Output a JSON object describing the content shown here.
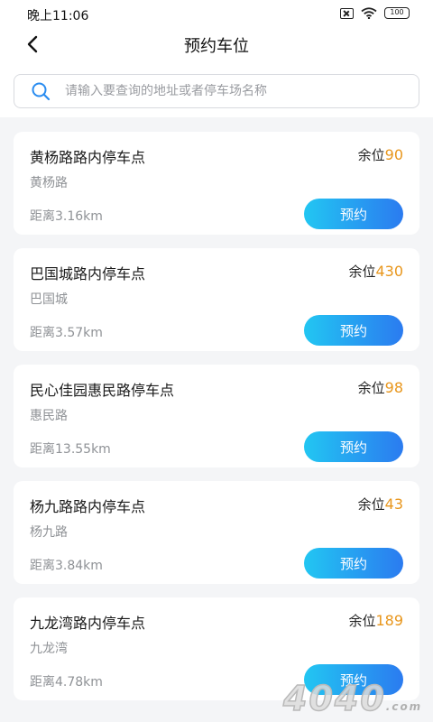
{
  "status_bar": {
    "time": "晚上11:06",
    "battery": "100"
  },
  "header": {
    "title": "预约车位"
  },
  "search": {
    "placeholder": "请输入要查询的地址或者停车场名称"
  },
  "spaces_prefix": "余位",
  "reserve_label": "预约",
  "lots": [
    {
      "name": "黄杨路路内停车点",
      "street": "黄杨路",
      "distance": "距离3.16km",
      "spaces": "90"
    },
    {
      "name": "巴国城路内停车点",
      "street": "巴国城",
      "distance": "距离3.57km",
      "spaces": "430"
    },
    {
      "name": "民心佳园惠民路停车点",
      "street": "惠民路",
      "distance": "距离13.55km",
      "spaces": "98"
    },
    {
      "name": "杨九路路内停车点",
      "street": "杨九路",
      "distance": "距离3.84km",
      "spaces": "43"
    },
    {
      "name": "九龙湾路内停车点",
      "street": "九龙湾",
      "distance": "距离4.78km",
      "spaces": "189"
    }
  ],
  "colors": {
    "accent_orange": "#e8961c",
    "button_gradient_start": "#22c6f2",
    "button_gradient_end": "#2b7bf0"
  },
  "watermark": {
    "text": "4040",
    "suffix": ".com"
  }
}
